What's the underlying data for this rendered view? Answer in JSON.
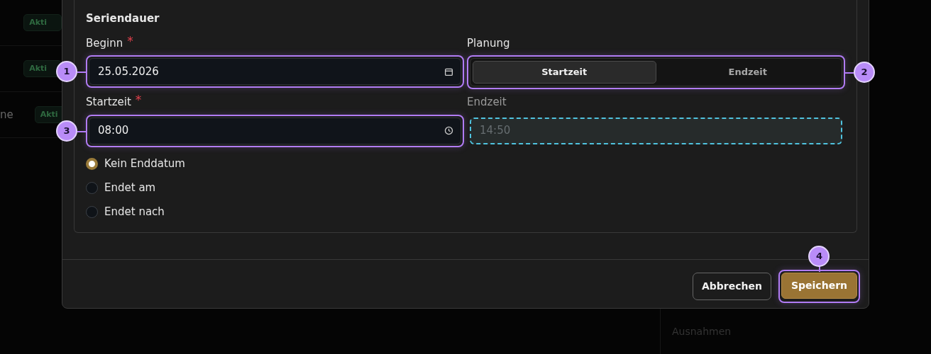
{
  "background": {
    "rows": [
      {
        "text": "",
        "badge": "Akti"
      },
      {
        "text": "",
        "badge": "Akti"
      },
      {
        "text": "ne",
        "badge": "Akti"
      }
    ],
    "side_label": "Ausnahmen"
  },
  "dialog": {
    "section_title": "Seriendauer",
    "start_date": {
      "label": "Beginn",
      "required_mark": "*",
      "value": "25.05.2026",
      "callout": "1"
    },
    "planning": {
      "label": "Planung",
      "callout": "2",
      "options": [
        {
          "label": "Startzeit",
          "selected": true
        },
        {
          "label": "Endzeit",
          "selected": false
        }
      ]
    },
    "start_time": {
      "label": "Startzeit",
      "required_mark": "*",
      "value": "08:00",
      "callout": "3"
    },
    "end_time": {
      "label": "Endzeit",
      "placeholder": "14:50",
      "disabled": true
    },
    "end_options": [
      {
        "label": "Kein Enddatum",
        "selected": true
      },
      {
        "label": "Endet am",
        "selected": false
      },
      {
        "label": "Endet nach",
        "selected": false
      }
    ],
    "buttons": [
      {
        "label": "Abbrechen",
        "kind": "secondary"
      },
      {
        "label": "Speichern",
        "kind": "primary",
        "callout": "4"
      }
    ]
  }
}
